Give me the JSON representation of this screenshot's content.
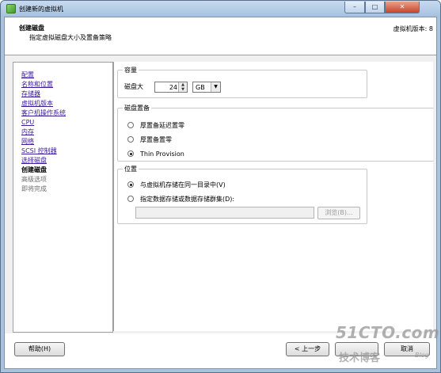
{
  "window": {
    "title": "创建新的虚拟机",
    "close_symbol": "✕",
    "minimize_symbol": "–",
    "maximize_symbol": "□"
  },
  "header": {
    "title": "创建磁盘",
    "subtitle": "指定虚拟磁盘大小及置备策略",
    "version": "虚拟机版本: 8"
  },
  "nav": {
    "completed": [
      "配置",
      "名称和位置",
      "存储器",
      "虚拟机版本",
      "客户机操作系统",
      "CPU",
      "内存",
      "网络",
      "SCSI 控制器",
      "选择磁盘"
    ],
    "current": "创建磁盘",
    "upcoming": [
      "高级选项",
      "即将完成"
    ]
  },
  "capacity": {
    "group_title": "容量",
    "size_label": "磁盘大",
    "size_value": "24",
    "unit_value": "GB"
  },
  "provisioning": {
    "group_title": "磁盘置备",
    "options": [
      "厚置备延迟置零",
      "厚置备置零",
      "Thin Provision"
    ],
    "selected_index": 2
  },
  "location": {
    "group_title": "位置",
    "option_same": "与虚拟机存储在同一目录中(V)",
    "option_specify": "指定数据存储或数据存储群集(D):",
    "path_value": "",
    "browse_label": "浏览(B)..."
  },
  "footer": {
    "help_label": "帮助(H)",
    "back_label": "< 上一步",
    "next_label": "",
    "cancel_label": "取消"
  },
  "watermark": {
    "main": "51CTO.com",
    "sub": "技术博客",
    "blog": "Blog"
  }
}
